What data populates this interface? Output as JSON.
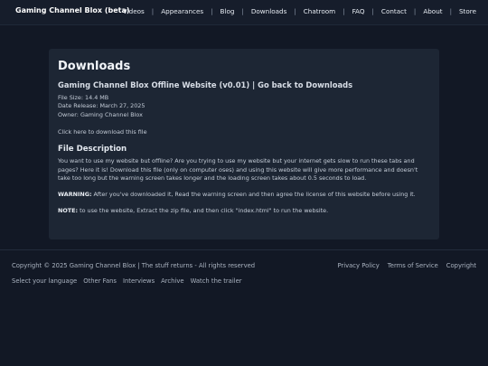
{
  "header": {
    "brand": "Gaming Channel Blox (beta)",
    "nav": [
      "Videos",
      "Appearances",
      "Blog",
      "Downloads",
      "Chatroom",
      "FAQ",
      "Contact",
      "About",
      "Store"
    ],
    "separator": "|"
  },
  "main": {
    "title": "Downloads",
    "subtitle": "Gaming Channel Blox Offline Website (v0.01) | Go back to Downloads",
    "file_size": "File Size: 14.4 MB",
    "date_release": "Date Release: March 27, 2025",
    "owner": "Owner: Gaming Channel Blox",
    "download_link": "Click here to download this file",
    "description_heading": "File Description",
    "description": "You want to use my website but offline? Are you trying to use my website but your internet gets slow to run these tabs and pages? Here it is! Download this file (only on computer oses) and using this website will give more performance and doesn't take too long but the warning screen takes longer and the loading screen takes about 0.5 seconds to load.",
    "warning_label": "WARNING:",
    "warning_text": " After you've downloaded it, Read the warning screen and then agree the license of this website before using it.",
    "note_label": "NOTE:",
    "note_text": " to use the website, Extract the zip file, and then click \"index.html\" to run the website."
  },
  "footer": {
    "copyright": "Copyright © 2025 Gaming Channel Blox | The stuff returns - All rights reserved",
    "right_links": [
      "Privacy Policy",
      "Terms of Service",
      "Copyright"
    ],
    "bottom_links": [
      "Select your language",
      "Other Fans",
      "Interviews",
      "Archive",
      "Watch the trailer"
    ]
  }
}
